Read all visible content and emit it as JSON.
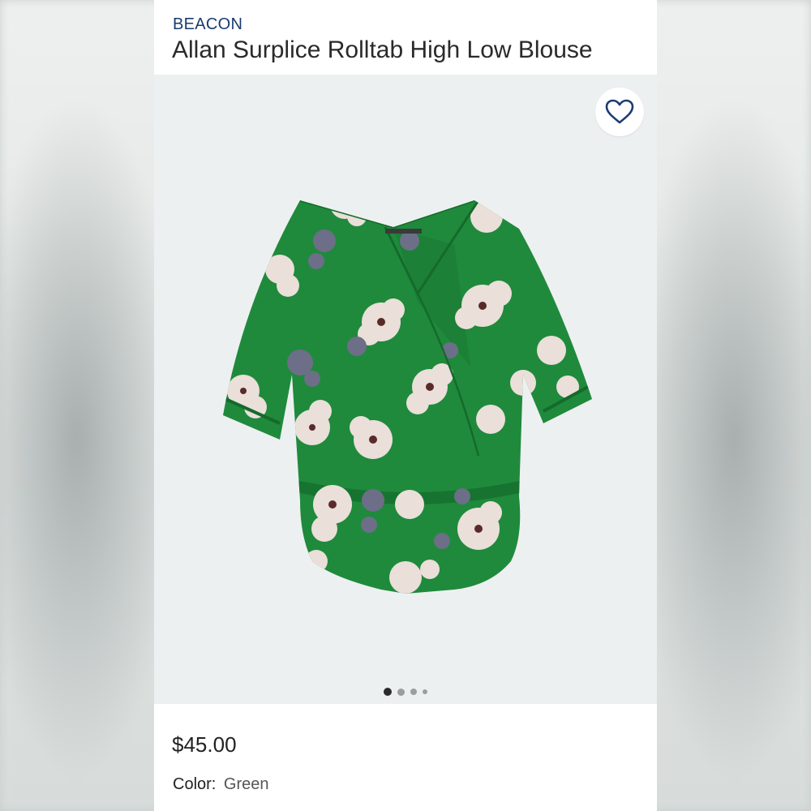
{
  "product": {
    "brand": "BEACON",
    "title": "Allan Surplice Rolltab High Low Blouse",
    "price": "$45.00",
    "color_label": "Color:",
    "color_value": "Green"
  },
  "favorite": {
    "icon": "heart-outline-icon",
    "color": "#1b3b6f"
  },
  "gallery": {
    "image_count": 4,
    "active_index": 0
  },
  "colors": {
    "brand_text": "#1b3b6f",
    "garment_green": "#1f8a3c",
    "media_background": "#edf0f0"
  }
}
